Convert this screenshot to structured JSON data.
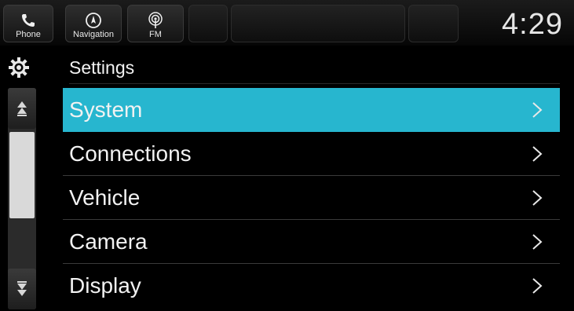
{
  "topbar": {
    "phone_label": "Phone",
    "navigation_label": "Navigation",
    "fm_label": "FM",
    "clock": "4:29"
  },
  "header": {
    "title": "Settings"
  },
  "menu": {
    "items": [
      {
        "label": "System",
        "selected": true
      },
      {
        "label": "Connections",
        "selected": false
      },
      {
        "label": "Vehicle",
        "selected": false
      },
      {
        "label": "Camera",
        "selected": false
      },
      {
        "label": "Display",
        "selected": false
      }
    ]
  },
  "icons": {
    "phone": "phone-icon",
    "navigation": "compass-icon",
    "fm": "radio-icon",
    "settings": "gear-icon",
    "scroll_up": "scroll-up-icon",
    "scroll_down": "scroll-down-icon",
    "chevron": "chevron-right-icon"
  },
  "colors": {
    "accent": "#27b6cf",
    "background": "#000000",
    "text": "#f2f2f2"
  }
}
